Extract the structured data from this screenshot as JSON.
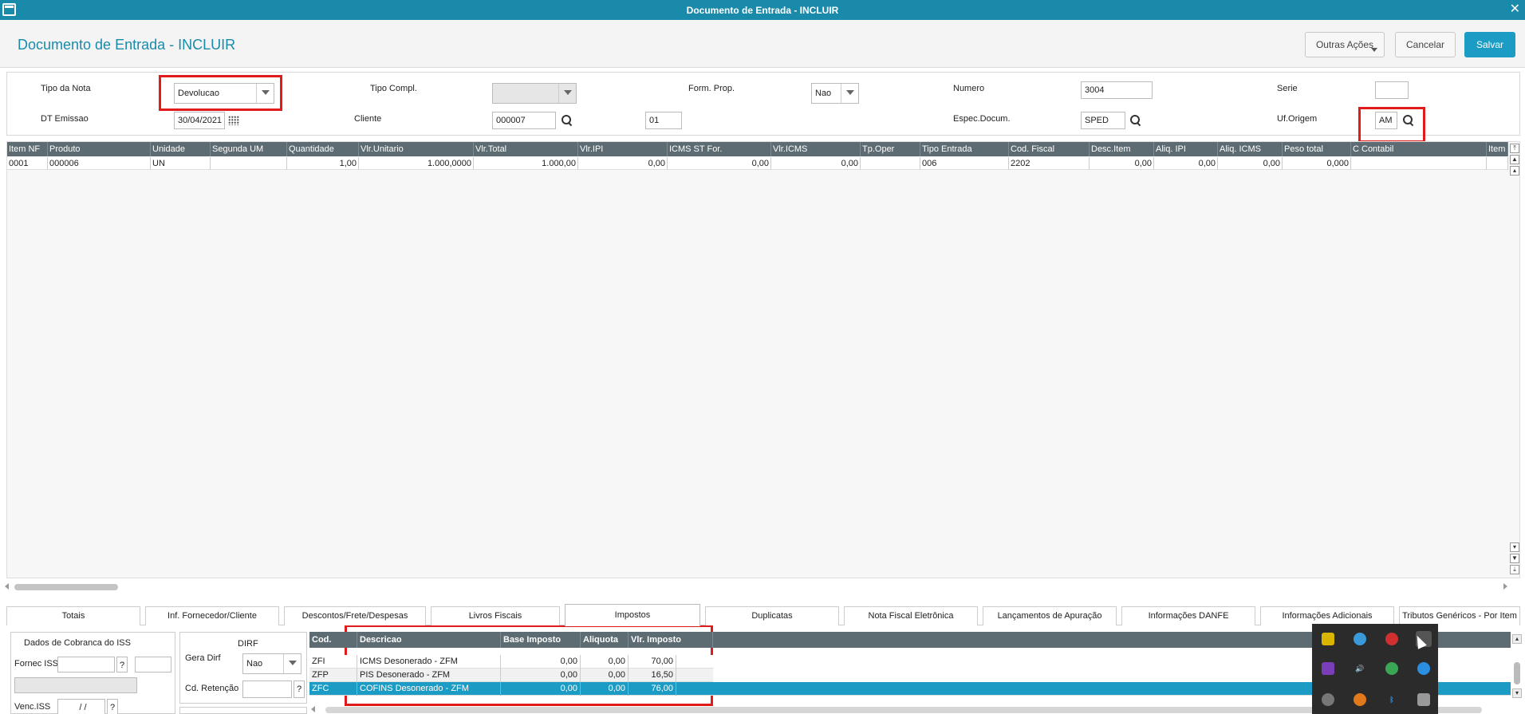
{
  "window": {
    "title": "Documento de Entrada - INCLUIR"
  },
  "header": {
    "title": "Documento de Entrada - INCLUIR",
    "buttons": {
      "outras_acoes": "Outras Ações",
      "cancelar": "Cancelar",
      "salvar": "Salvar"
    }
  },
  "form": {
    "tipo_nota": {
      "label": "Tipo da Nota",
      "value": "Devolucao"
    },
    "tipo_compl": {
      "label": "Tipo Compl.",
      "value": ""
    },
    "form_prop": {
      "label": "Form. Prop.",
      "value": "Nao"
    },
    "numero": {
      "label": "Numero",
      "value": "3004"
    },
    "serie": {
      "label": "Serie",
      "value": ""
    },
    "dt_emissao": {
      "label": "DT Emissao",
      "value": "30/04/2021"
    },
    "cliente": {
      "label": "Cliente",
      "value": "000007",
      "loja": "01"
    },
    "espec_docum": {
      "label": "Espec.Docum.",
      "value": "SPED"
    },
    "uf_origem": {
      "label": "Uf.Origem",
      "value": "AM"
    }
  },
  "items_grid": {
    "columns": [
      "Item NF",
      "Produto",
      "Unidade",
      "Segunda UM",
      "Quantidade",
      "Vlr.Unitario",
      "Vlr.Total",
      "Vlr.IPI",
      "ICMS ST For.",
      "Vlr.ICMS",
      "Tp.Oper",
      "Tipo Entrada",
      "Cod. Fiscal",
      "Desc.Item",
      "Aliq. IPI",
      "Aliq. ICMS",
      "Peso total",
      "C Contabil",
      "Item Co"
    ],
    "rows": [
      [
        "0001",
        "000006",
        "UN",
        "",
        "1,00",
        "1.000,0000",
        "1.000,00",
        "0,00",
        "0,00",
        "0,00",
        "",
        "006",
        "2202",
        "0,00",
        "0,00",
        "0,00",
        "0,000",
        "",
        ""
      ]
    ]
  },
  "tabs": [
    "Totais",
    "Inf. Fornecedor/Cliente",
    "Descontos/Frete/Despesas",
    "Livros Fiscais",
    "Impostos",
    "Duplicatas",
    "Nota Fiscal Eletrônica",
    "Lançamentos de Apuração",
    "Informações DANFE",
    "Informações Adicionais",
    "Tributos Genéricos - Por Item"
  ],
  "active_tab": "Impostos",
  "iss_panel": {
    "title": "Dados de Cobranca do ISS",
    "fornec_iss_label": "Fornec ISS",
    "venc_iss_label": "Venc.ISS",
    "venc_iss_value": "/ /",
    "help": "?"
  },
  "dirf_panel": {
    "title": "DIRF",
    "gera_dirf_label": "Gera Dirf",
    "gera_dirf_value": "Nao",
    "cd_retencao_label": "Cd. Retenção",
    "help": "?"
  },
  "tax_grid": {
    "columns": [
      "Cod.",
      "Descricao",
      "Base Imposto",
      "Aliquota",
      "Vlr. Imposto"
    ],
    "rows": [
      [
        "ZFI",
        "ICMS Desonerado - ZFM",
        "0,00",
        "0,00",
        "70,00"
      ],
      [
        "ZFP",
        "PIS Desonerado - ZFM",
        "0,00",
        "0,00",
        "16,50"
      ],
      [
        "ZFC",
        "COFINS Desonerado - ZFM",
        "0,00",
        "0,00",
        "76,00"
      ]
    ],
    "selected_row": 2
  },
  "colors": {
    "accent": "#1a9cc4",
    "grid_header": "#5d6c72",
    "highlight": "#e01b1b"
  }
}
